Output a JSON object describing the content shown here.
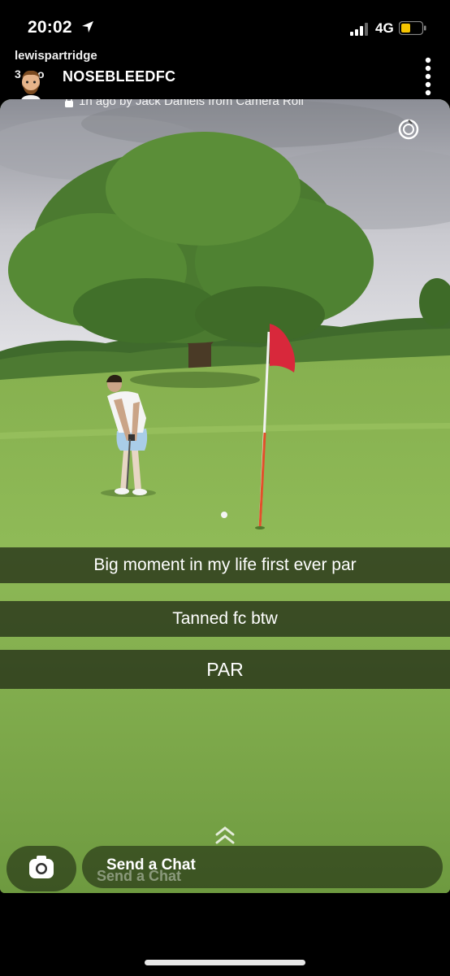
{
  "status_bar": {
    "time": "20:02",
    "network": "4G",
    "icons": [
      "location-arrow-icon",
      "signal-icon",
      "battery-icon"
    ],
    "battery_color": "#f5c400"
  },
  "story": {
    "username": "lewispartridge",
    "ago": "3 ago",
    "title": "NOSEBLEEDFC",
    "meta": "1h ago by Jack Daniels from Camera Roll"
  },
  "captions": [
    "Big moment in my life first ever par",
    "Tanned fc btw",
    "PAR"
  ],
  "chat": {
    "label": "Send a Chat",
    "shadow_label": "Send a Chat"
  },
  "colors": {
    "flag": "#d8283b",
    "grass": "#7ea54c"
  }
}
